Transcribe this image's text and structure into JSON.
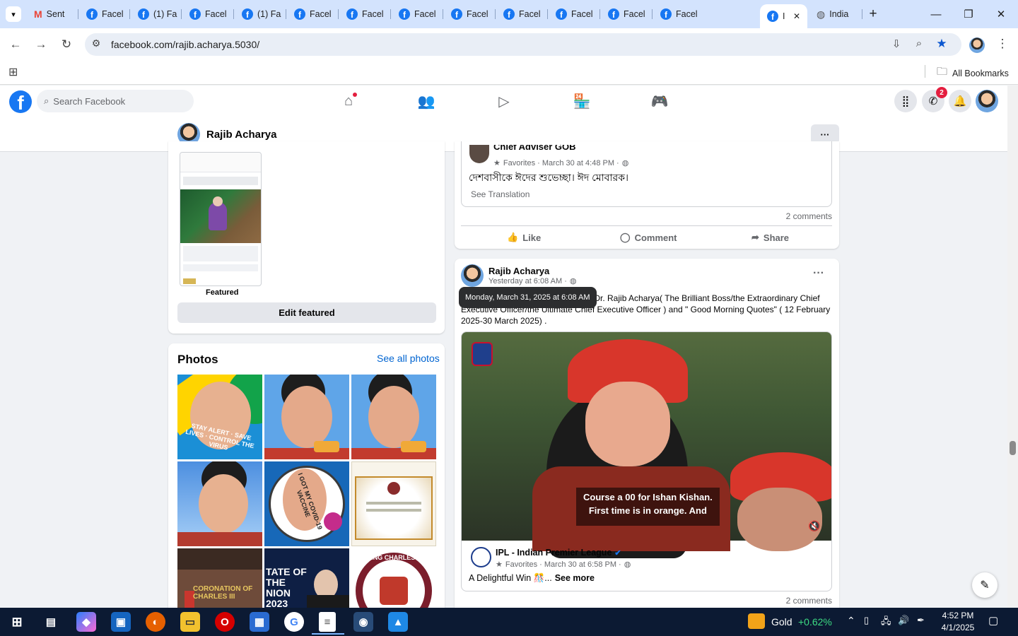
{
  "browser": {
    "tabs": [
      {
        "label": "Sent",
        "icon": "gmail-icon"
      },
      {
        "label": "Facel",
        "icon": "facebook-icon"
      },
      {
        "label": "(1) Fa",
        "icon": "facebook-icon"
      },
      {
        "label": "Facel",
        "icon": "facebook-icon"
      },
      {
        "label": "(1) Fa",
        "icon": "facebook-icon"
      },
      {
        "label": "Facel",
        "icon": "facebook-icon"
      },
      {
        "label": "Facel",
        "icon": "facebook-icon"
      },
      {
        "label": "Facel",
        "icon": "facebook-icon"
      },
      {
        "label": "Facel",
        "icon": "facebook-icon"
      },
      {
        "label": "Facel",
        "icon": "facebook-icon"
      },
      {
        "label": "Facel",
        "icon": "facebook-icon"
      },
      {
        "label": "Facel",
        "icon": "facebook-icon"
      },
      {
        "label": "Facel",
        "icon": "facebook-icon"
      },
      {
        "label": "I",
        "icon": "facebook-icon"
      },
      {
        "label": "India",
        "icon": "globe-icon"
      }
    ],
    "url": "facebook.com/rajib.acharya.5030/",
    "bookmarks_label": "All Bookmarks"
  },
  "fb": {
    "search_placeholder": "Search Facebook",
    "notif_count": "2",
    "profile_name": "Rajib Acharya",
    "more_label": "···"
  },
  "left": {
    "featured_label": "Featured",
    "edit_featured": "Edit featured",
    "photos_title": "Photos",
    "see_all_photos": "See all photos",
    "photo1_text": "STAY ALERT · SAVE LIVES · CONTROL THE VIRUS",
    "photo5_text": "I GOT MY COVID-19 VACCINE",
    "photo7_text": "CORONATION OF CHARLES III",
    "photo8_text": "TATE OF THE NION 2023",
    "photo9_text": "KING CHARLES III"
  },
  "post1": {
    "author": "Chief Adviser GOB",
    "meta": "Favorites · March 30 at 4:48 PM ·",
    "text": "দেশবাসীকে ঈদের শুভেচ্ছা। ঈদ মোবারক।",
    "translation": "See Translation",
    "comments": "2 comments",
    "like": "Like",
    "comment": "Comment",
    "share": "Share"
  },
  "post2": {
    "author": "Rajib Acharya",
    "time": "Yesterday at 6:08 AM ·",
    "tooltip": "Monday, March 31, 2025 at 6:08 AM",
    "text_line1": "ador Dr. Rajib Acharya( The Brilliant Boss/the Extraordinary Chief",
    "text_line2": "Executive Officer/the Ultimate Chief Executive Officer ) and \" Good Morning Quotes\" ( 12 February",
    "text_line3": "2025-30 March 2025) .",
    "caption_line1": "Course a 00 for Ishan Kishan.",
    "caption_line2": "First time is in orange. And",
    "shared_author": "IPL - Indian Premier League",
    "shared_meta": "Favorites · March 30 at 6:58 PM ·",
    "shared_text": "A Delightful Win 🎊...",
    "see_more": "See more",
    "comments": "2 comments"
  },
  "taskbar": {
    "stock_name": "Gold",
    "stock_change": "+0.62%",
    "time": "4:52 PM",
    "date": "4/1/2025"
  }
}
